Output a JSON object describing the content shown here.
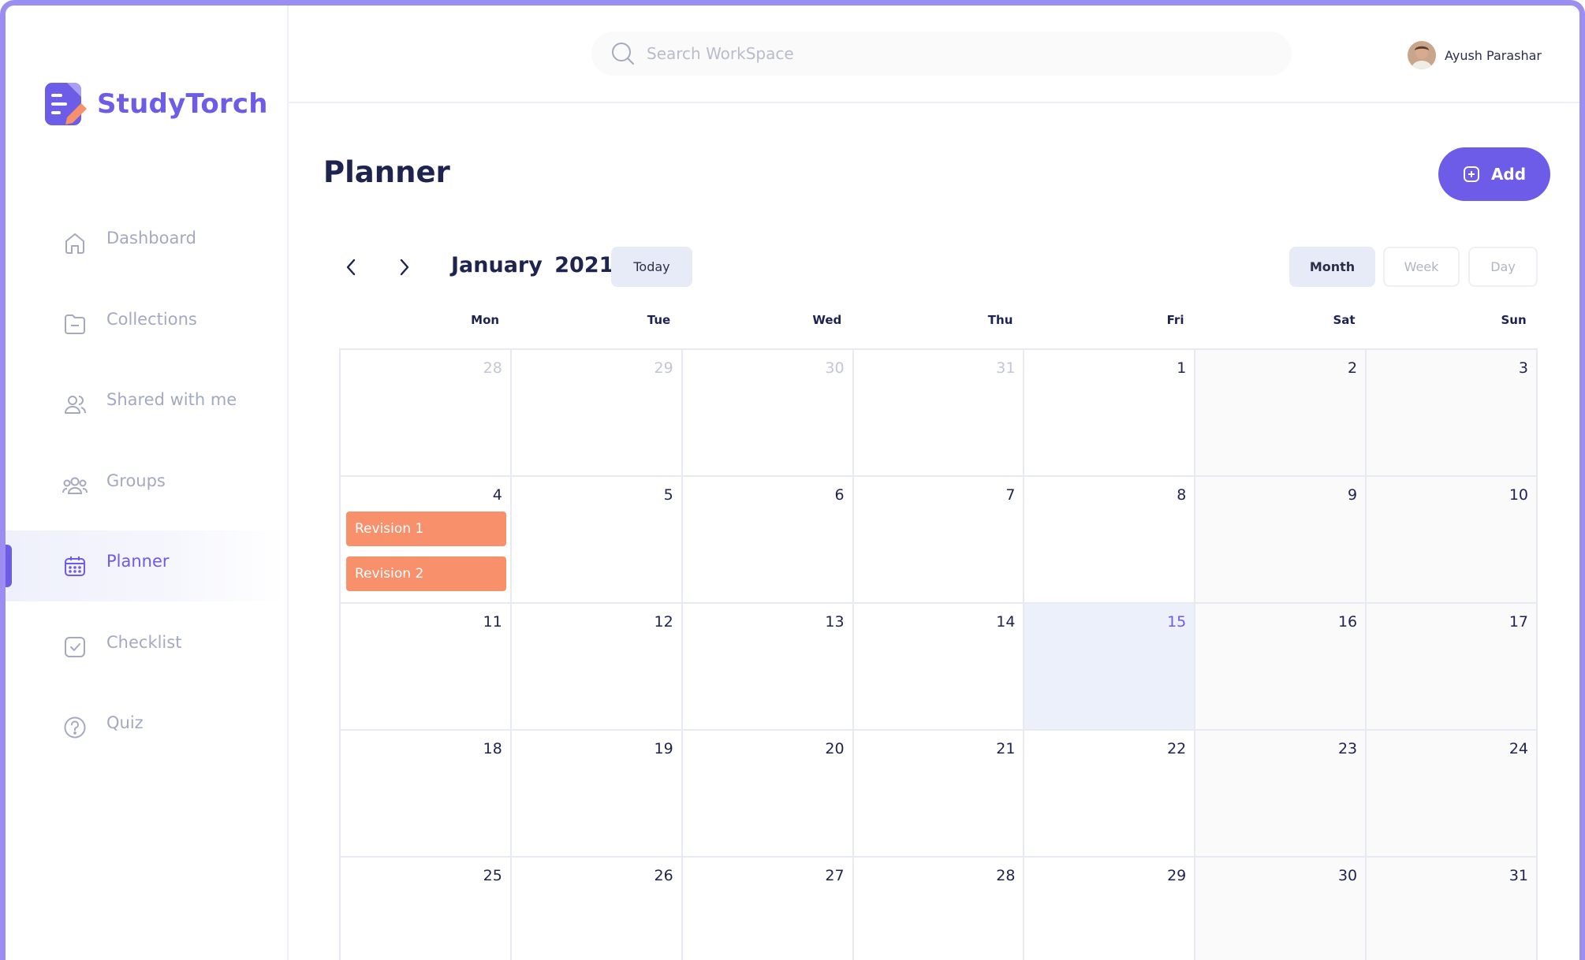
{
  "app": {
    "brand": "StudyTorch"
  },
  "colors": {
    "accent": "#6c5ce7",
    "frame": "#9b8df2",
    "event": "#f7906b",
    "today_bg": "#ebf0fa"
  },
  "sidebar": {
    "items": [
      {
        "label": "Dashboard",
        "icon": "home-icon",
        "active": false
      },
      {
        "label": "Collections",
        "icon": "folder-icon",
        "active": false
      },
      {
        "label": "Shared with me",
        "icon": "shared-users-icon",
        "active": false
      },
      {
        "label": "Groups",
        "icon": "groups-icon",
        "active": false
      },
      {
        "label": "Planner",
        "icon": "calendar-icon",
        "active": true
      },
      {
        "label": "Checklist",
        "icon": "checkbox-icon",
        "active": false
      },
      {
        "label": "Quiz",
        "icon": "question-icon",
        "active": false
      }
    ]
  },
  "header": {
    "search_placeholder": "Search WorkSpace",
    "search_value": "",
    "user_name": "Ayush Parashar"
  },
  "main": {
    "title": "Planner",
    "add_label": "Add"
  },
  "calendar": {
    "month": "January",
    "year": "2021",
    "today_label": "Today",
    "views": {
      "month": "Month",
      "week": "Week",
      "day": "Day"
    },
    "active_view": "Month",
    "weekdays": [
      "Mon",
      "Tue",
      "Wed",
      "Thu",
      "Fri",
      "Sat",
      "Sun"
    ],
    "weeks": [
      [
        {
          "day": "28",
          "outside": true
        },
        {
          "day": "29",
          "outside": true
        },
        {
          "day": "30",
          "outside": true
        },
        {
          "day": "31",
          "outside": true
        },
        {
          "day": "1"
        },
        {
          "day": "2"
        },
        {
          "day": "3"
        }
      ],
      [
        {
          "day": "4",
          "events": [
            "Revision 1",
            "Revision 2"
          ]
        },
        {
          "day": "5"
        },
        {
          "day": "6"
        },
        {
          "day": "7"
        },
        {
          "day": "8"
        },
        {
          "day": "9"
        },
        {
          "day": "10"
        }
      ],
      [
        {
          "day": "11"
        },
        {
          "day": "12"
        },
        {
          "day": "13"
        },
        {
          "day": "14"
        },
        {
          "day": "15",
          "today": true
        },
        {
          "day": "16"
        },
        {
          "day": "17"
        }
      ],
      [
        {
          "day": "18"
        },
        {
          "day": "19"
        },
        {
          "day": "20"
        },
        {
          "day": "21"
        },
        {
          "day": "22"
        },
        {
          "day": "23"
        },
        {
          "day": "24"
        }
      ],
      [
        {
          "day": "25"
        },
        {
          "day": "26"
        },
        {
          "day": "27"
        },
        {
          "day": "28"
        },
        {
          "day": "29"
        },
        {
          "day": "30"
        },
        {
          "day": "31"
        }
      ]
    ]
  }
}
